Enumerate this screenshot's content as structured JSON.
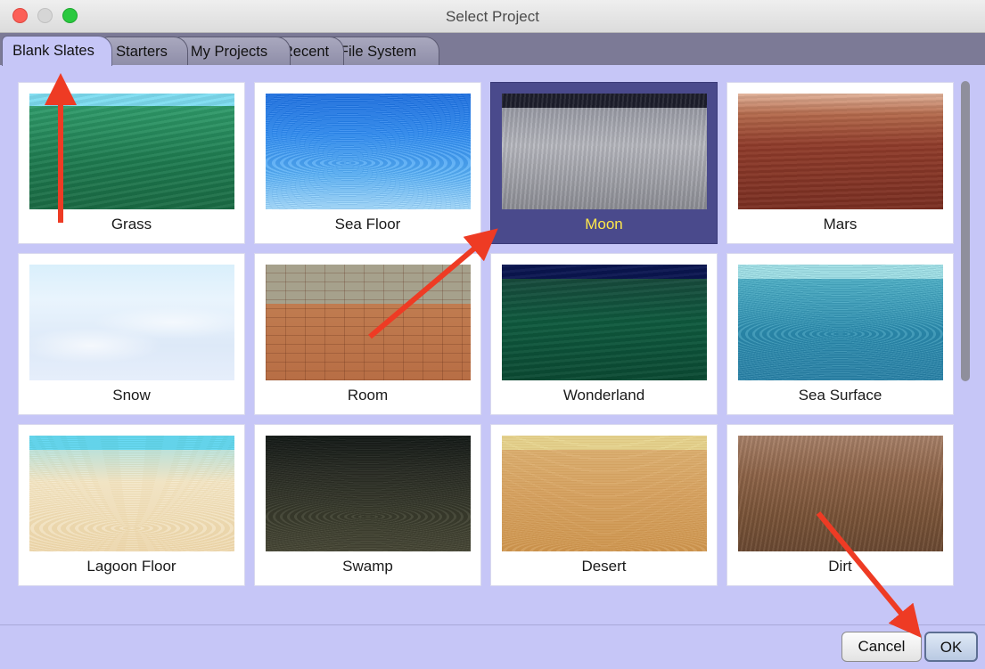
{
  "window": {
    "title": "Select Project"
  },
  "tabs": [
    {
      "label": "Blank Slates",
      "active": true
    },
    {
      "label": "Starters"
    },
    {
      "label": "My Projects"
    },
    {
      "label": "Recent"
    },
    {
      "label": "File System"
    }
  ],
  "templates": [
    {
      "label": "Grass",
      "selected": false
    },
    {
      "label": "Sea Floor",
      "selected": false
    },
    {
      "label": "Moon",
      "selected": true
    },
    {
      "label": "Mars",
      "selected": false
    },
    {
      "label": "Snow",
      "selected": false
    },
    {
      "label": "Room",
      "selected": false
    },
    {
      "label": "Wonderland",
      "selected": false
    },
    {
      "label": "Sea Surface",
      "selected": false
    },
    {
      "label": "Lagoon Floor",
      "selected": false
    },
    {
      "label": "Swamp",
      "selected": false
    },
    {
      "label": "Desert",
      "selected": false
    },
    {
      "label": "Dirt",
      "selected": false
    }
  ],
  "buttons": {
    "cancel": "Cancel",
    "ok": "OK"
  },
  "colors": {
    "annotation_arrow": "#ee3b24",
    "selection": "#4a4a8c",
    "selected_label": "#ffe84a",
    "panel": "#c6c6f7"
  }
}
